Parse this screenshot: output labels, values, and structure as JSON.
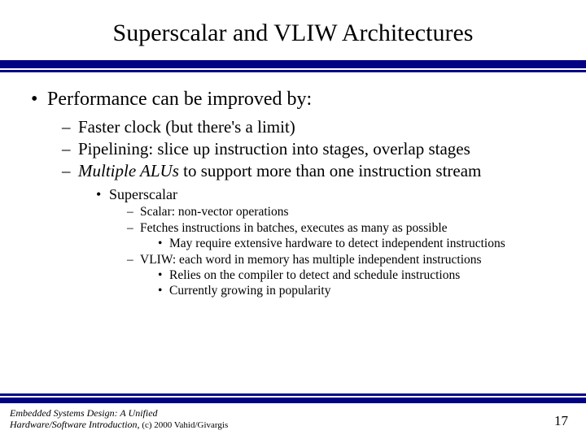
{
  "title": "Superscalar and VLIW Architectures",
  "bullets": {
    "l1": "Performance can be improved by:",
    "l2a": "Faster clock (but there's a limit)",
    "l2b": "Pipelining: slice up instruction into stages, overlap stages",
    "l2c_pre": "Multiple ALUs",
    "l2c_post": " to support more than one instruction stream",
    "l3a": "Superscalar",
    "l4a": "Scalar: non-vector operations",
    "l4b": "Fetches instructions in batches, executes as many as possible",
    "l5a": "May require extensive hardware to detect independent instructions",
    "l4c": "VLIW: each word in memory has multiple independent instructions",
    "l5b": "Relies on the compiler to detect and schedule instructions",
    "l5c": "Currently growing in popularity"
  },
  "footer": {
    "line1": "Embedded Systems Design: A Unified",
    "line2_pre": "Hardware/Software Introduction,",
    "line2_post": " (c) 2000 Vahid/Givargis"
  },
  "page": "17"
}
